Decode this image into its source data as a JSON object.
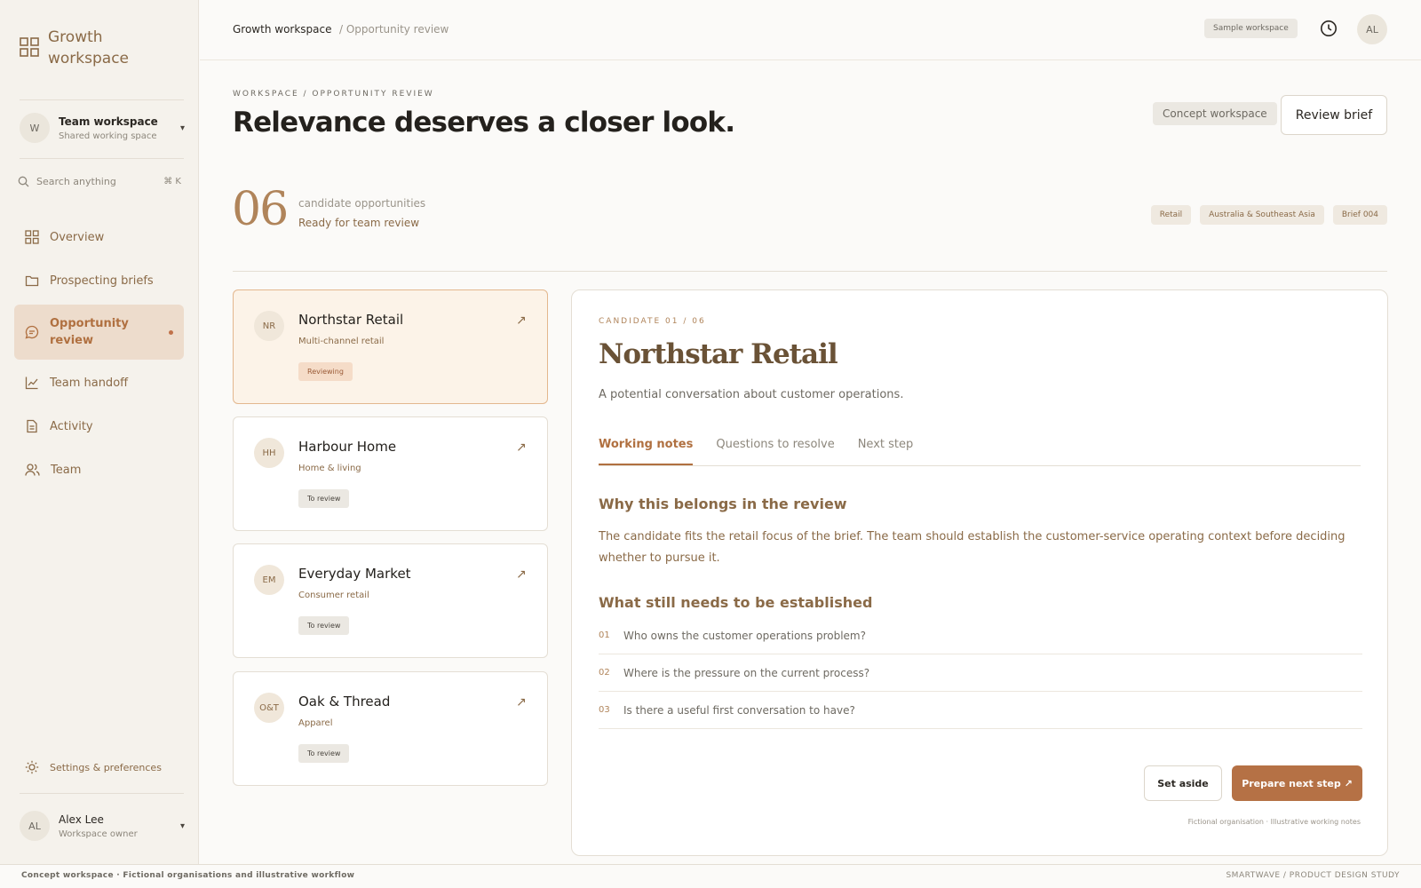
{
  "sidebar": {
    "logo_title": "Growth workspace",
    "team": {
      "initial": "W",
      "title": "Team workspace",
      "subtitle": "Shared working space"
    },
    "search": {
      "placeholder": "Search anything",
      "shortcut": "⌘ K"
    },
    "nav": [
      {
        "label": "Overview",
        "icon": "grid-icon"
      },
      {
        "label": "Prospecting briefs",
        "icon": "folder-icon"
      },
      {
        "label": "Opportunity review",
        "icon": "chat-icon",
        "active": true
      },
      {
        "label": "Team handoff",
        "icon": "chart-icon"
      },
      {
        "label": "Activity",
        "icon": "document-icon"
      },
      {
        "label": "Team",
        "icon": "users-icon"
      }
    ],
    "settings_label": "Settings & preferences",
    "user": {
      "initials": "AL",
      "name": "Alex Lee",
      "role": "Workspace owner"
    }
  },
  "topbar": {
    "crumb_root": "Growth workspace",
    "crumb_current": "/ Opportunity review",
    "sample_badge": "Sample workspace",
    "user_initials": "AL"
  },
  "header": {
    "eyebrow": "WORKSPACE / OPPORTUNITY REVIEW",
    "title": "Relevance deserves a closer look.",
    "concept_badge": "Concept workspace",
    "review_brief_label": "Review brief"
  },
  "summary": {
    "count": "06",
    "label": "candidate opportunities",
    "status": "Ready for team review",
    "tags": [
      "Retail",
      "Australia & Southeast Asia",
      "Brief 004"
    ]
  },
  "candidates": [
    {
      "initials": "NR",
      "name": "Northstar Retail",
      "sector": "Multi-channel retail",
      "status": "Reviewing",
      "selected": true
    },
    {
      "initials": "HH",
      "name": "Harbour Home",
      "sector": "Home & living",
      "status": "To review"
    },
    {
      "initials": "EM",
      "name": "Everyday Market",
      "sector": "Consumer retail",
      "status": "To review"
    },
    {
      "initials": "O&T",
      "name": "Oak & Thread",
      "sector": "Apparel",
      "status": "To review"
    }
  ],
  "detail": {
    "eyebrow": "CANDIDATE 01 / 06",
    "title": "Northstar Retail",
    "subtitle": "A potential conversation about customer operations.",
    "tabs": [
      "Working notes",
      "Questions to resolve",
      "Next step"
    ],
    "why_heading": "Why this belongs in the review",
    "why_body": "The candidate fits the retail focus of the brief. The team should establish the customer-service operating context before deciding whether to pursue it.",
    "what_heading": "What still needs to be established",
    "questions": [
      {
        "num": "01",
        "text": "Who owns the customer operations problem?"
      },
      {
        "num": "02",
        "text": "Where is the pressure on the current process?"
      },
      {
        "num": "03",
        "text": "Is there a useful first conversation to have?"
      }
    ],
    "set_aside_label": "Set aside",
    "prepare_label": "Prepare next step ↗",
    "fine_print": "Fictional organisation · Illustrative working notes"
  },
  "footer": {
    "left": "Concept workspace · Fictional organisations and illustrative workflow",
    "right": "SMARTWAVE / PRODUCT DESIGN STUDY"
  },
  "colors": {
    "accent": "#b57145",
    "accent_text": "#8a6a47",
    "selected_card_bg": "#fcf3e8",
    "sidebar_bg": "#f5f2ec"
  }
}
